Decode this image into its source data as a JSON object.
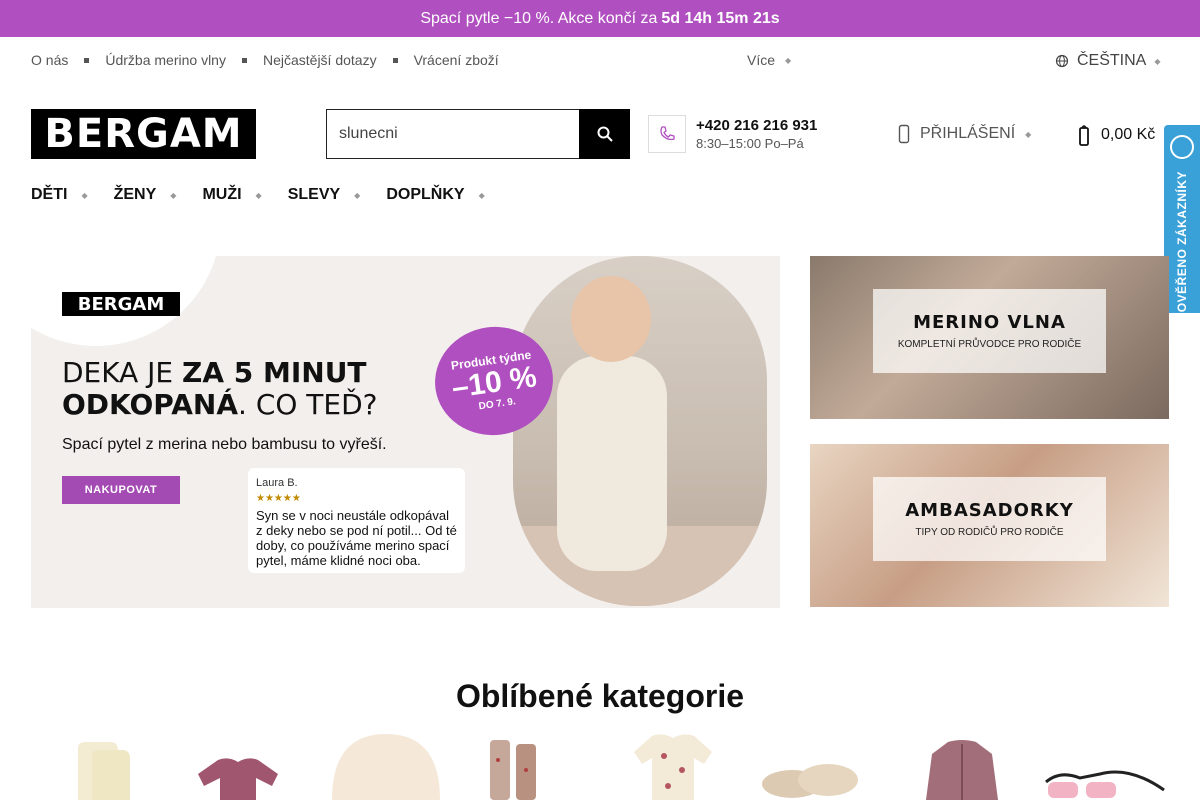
{
  "promo": {
    "text": "Spací pytle −10 %. Akce končí za",
    "countdown": "5d 14h 15m 21s"
  },
  "top_links": [
    "O nás",
    "Údržba merino vlny",
    "Nejčastější dotazy",
    "Vrácení zboží"
  ],
  "more_label": "Více",
  "language": "ČEŠTINA",
  "logo_text": "BERGAM",
  "search": {
    "value": "slunecni"
  },
  "contact": {
    "phone": "+420 216 216 931",
    "hours": "8:30–15:00 Po–Pá"
  },
  "login_label": "PŘIHLÁŠENÍ",
  "cart_total": "0,00 Kč",
  "main_nav": [
    "DĚTI",
    "ŽENY",
    "MUŽI",
    "SLEVY",
    "DOPLŇKY"
  ],
  "verified_badge": "OVĚŘENO ZÁKAZNÍKY",
  "hero": {
    "logo": "BERGAM",
    "headline_line1_regular": "DEKA JE ",
    "headline_line1_bold": "ZA 5 MINUT",
    "headline_line2_bold": "ODKOPANÁ",
    "headline_line2_regular": ". CO TEĎ?",
    "subtitle": "Spací pytel z merina nebo bambusu to vyřeší.",
    "cta": "NAKUPOVAT",
    "sticker_line1": "Produkt týdne",
    "sticker_line2": "–10 %",
    "sticker_line3": "DO 7. 9.",
    "review_name": "Laura B.",
    "review_stars": "★★★★★",
    "review_text": "Syn se v noci neustále odkopával z deky nebo se pod ní potil... Od té doby, co používáme merino spací pytel, máme klidné noci oba."
  },
  "side_banners": [
    {
      "title": "MERINO VLNA",
      "subtitle": "KOMPLETNÍ PRŮVODCE PRO RODIČE"
    },
    {
      "title": "AMBASADORKY",
      "subtitle": "TIPY OD RODIČŮ PRO RODIČE"
    }
  ],
  "categories_title": "Oblíbené kategorie",
  "colors": {
    "accent": "#b04fbf",
    "cta": "#a44ab3",
    "verified": "#3aa0d8"
  }
}
